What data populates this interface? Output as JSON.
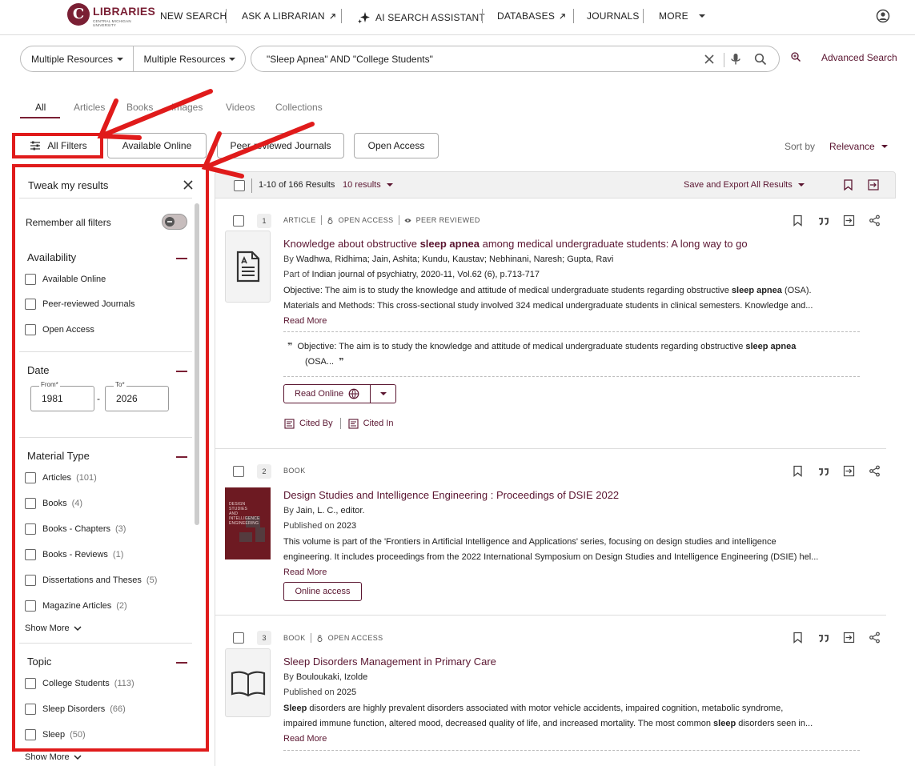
{
  "brand": {
    "logo_letter": "C",
    "name": "LIBRARIES",
    "sub": "CENTRAL MICHIGAN UNIVERSITY"
  },
  "nav": {
    "new_search": "NEW SEARCH",
    "ask_librarian": "ASK A LIBRARIAN",
    "ai_search": "AI SEARCH ASSISTANT",
    "databases": "DATABASES",
    "journals": "JOURNALS",
    "more": "MORE"
  },
  "search": {
    "scope1": "Multiple Resources",
    "scope2": "Multiple Resources",
    "query": "\"Sleep Apnea\" AND \"College Students\"",
    "advanced": "Advanced Search"
  },
  "tabs": [
    "All",
    "Articles",
    "Books",
    "Images",
    "Videos",
    "Collections"
  ],
  "chips": {
    "all_filters": "All Filters",
    "available_online": "Available Online",
    "peer_reviewed": "Peer-reviewed Journals",
    "open_access": "Open Access"
  },
  "sort": {
    "label": "Sort by",
    "value": "Relevance"
  },
  "sidebar": {
    "title": "Tweak my results",
    "remember": "Remember all filters",
    "availability": {
      "heading": "Availability",
      "items": [
        "Available Online",
        "Peer-reviewed Journals",
        "Open Access"
      ]
    },
    "date": {
      "heading": "Date",
      "from_label": "From*",
      "from": "1981",
      "to_label": "To*",
      "to": "2026",
      "dash": "-"
    },
    "material": {
      "heading": "Material Type",
      "items": [
        {
          "label": "Articles",
          "count": "(101)"
        },
        {
          "label": "Books",
          "count": "(4)"
        },
        {
          "label": "Books - Chapters",
          "count": "(3)"
        },
        {
          "label": "Books - Reviews",
          "count": "(1)"
        },
        {
          "label": "Dissertations and Theses",
          "count": "(5)"
        },
        {
          "label": "Magazine Articles",
          "count": "(2)"
        }
      ],
      "show_more": "Show More"
    },
    "topic": {
      "heading": "Topic",
      "items": [
        {
          "label": "College Students",
          "count": "(113)"
        },
        {
          "label": "Sleep Disorders",
          "count": "(66)"
        },
        {
          "label": "Sleep",
          "count": "(50)"
        }
      ],
      "show_more": "Show More"
    }
  },
  "results_header": {
    "range": "1-10 of 166 Results",
    "per_page": "10 results",
    "save_export": "Save and Export All Results"
  },
  "results": [
    {
      "num": "1",
      "type": "ARTICLE",
      "badges": [
        "OPEN ACCESS",
        "PEER REVIEWED"
      ],
      "title_pre": "Knowledge about obstructive ",
      "title_hl": "sleep apnea",
      "title_post": " among medical undergraduate students: A long way to go",
      "authors_prefix": "By ",
      "authors": "Wadhwa, Ridhima; Jain, Ashita; Kundu, Kaustav; Nebhinani, Naresh; Gupta, Ravi",
      "part_prefix": "Part of ",
      "part": "Indian journal of psychiatry, 2020-11, Vol.62 (6), p.713-717",
      "abs1_pre": "Objective: The aim is to study the knowledge and attitude of medical undergraduate students regarding obstructive ",
      "abs1_hl": "sleep apnea",
      "abs1_post": " (OSA).",
      "abs2": "Materials and Methods: This cross-sectional study involved 324 medical undergraduate students in clinical semesters. Knowledge and...",
      "read_more": "Read More",
      "quote_pre": "Objective: The aim is to study the knowledge and attitude of medical undergraduate students regarding obstructive ",
      "quote_hl": "sleep apnea",
      "quote_post": " (OSA...",
      "read_online": "Read Online",
      "cited_by": "Cited By",
      "cited_in": "Cited In"
    },
    {
      "num": "2",
      "type": "BOOK",
      "cover_text": "DESIGN STUDIES AND INTELLIGENCE ENGINEERING",
      "title": "Design Studies and Intelligence Engineering : Proceedings of DSIE 2022",
      "authors_prefix": "By ",
      "authors": "Jain, L. C., editor.",
      "pub_prefix": "Published on ",
      "pub": "2023",
      "abs1": "This volume is part of the 'Frontiers in Artificial Intelligence and Applications' series, focusing on design studies and intelligence",
      "abs2": "engineering. It includes proceedings from the 2022 International Symposium on Design Studies and Intelligence Engineering (DSIE) hel...",
      "read_more": "Read More",
      "online_access": "Online access"
    },
    {
      "num": "3",
      "type": "BOOK",
      "badges": [
        "OPEN ACCESS"
      ],
      "title": "Sleep Disorders Management in Primary Care",
      "authors_prefix": "By ",
      "authors": "Bouloukaki, Izolde",
      "pub_prefix": "Published on ",
      "pub": "2025",
      "abs1_hl": "Sleep",
      "abs1_post": " disorders are highly prevalent disorders associated with motor vehicle accidents, impaired cognition, metabolic syndrome,",
      "abs2_pre": "impaired immune function, altered mood, decreased quality of life, and increased mortality. The most common ",
      "abs2_hl": "sleep",
      "abs2_post": " disorders seen in...",
      "read_more": "Read More"
    }
  ],
  "colors": {
    "brand": "#7a1f34",
    "link": "#5a1530",
    "annotation": "#e01b1b"
  }
}
